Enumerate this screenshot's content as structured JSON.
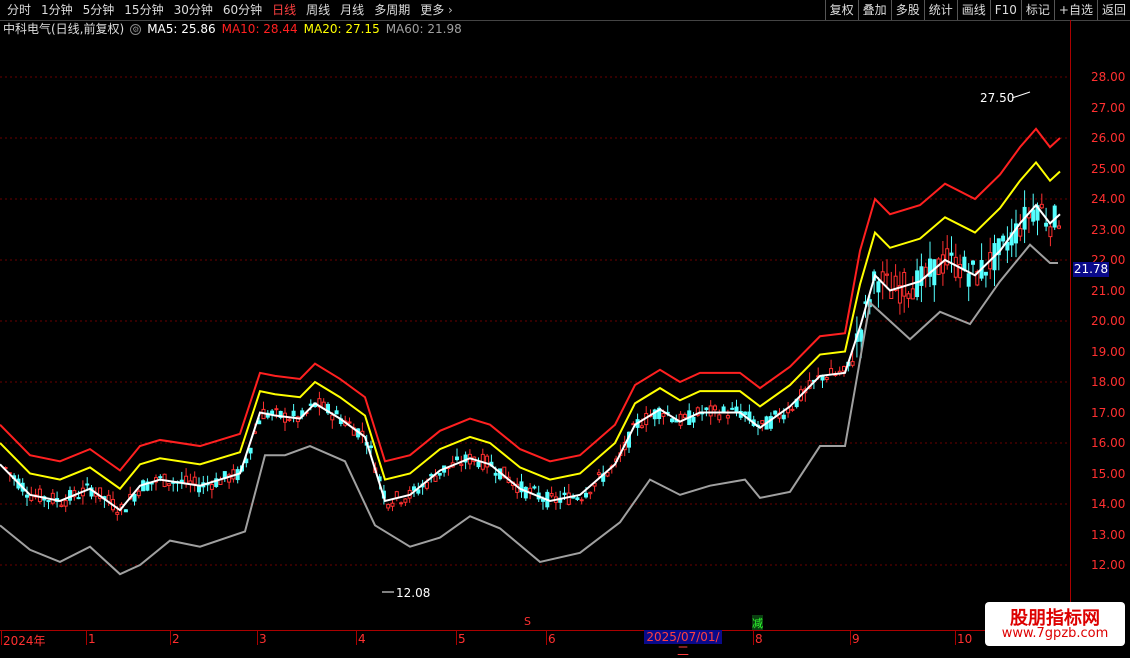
{
  "topbar": {
    "periods": [
      "分时",
      "1分钟",
      "5分钟",
      "15分钟",
      "30分钟",
      "60分钟",
      "日线",
      "周线",
      "月线",
      "多周期",
      "更多"
    ],
    "active_period": "日线",
    "tools": [
      "复权",
      "叠加",
      "多股",
      "统计",
      "画线",
      "F10",
      "标记",
      "+自选",
      "返回"
    ]
  },
  "legend": {
    "stock_name": "中科电气(日线,前复权)",
    "ma5": "MA5: 25.86",
    "ma10": "MA10: 28.44",
    "ma20": "MA20: 27.15",
    "ma60": "MA60: 21.98",
    "colors": {
      "ma5": "#ffffff",
      "ma10": "#ff2020",
      "ma20": "#ffff00",
      "ma60": "#a0a0a0"
    }
  },
  "price_axis": {
    "ticks": [
      "28.00",
      "27.00",
      "26.00",
      "25.00",
      "24.00",
      "23.00",
      "22.00",
      "21.00",
      "20.00",
      "19.00",
      "18.00",
      "17.00",
      "16.00",
      "15.00",
      "14.00",
      "13.00",
      "12.00"
    ],
    "current_price": "21.78"
  },
  "annotations": {
    "high_label": "27.50",
    "low_label": "12.08",
    "s_marker": "S",
    "reduce_marker": "减"
  },
  "bottom": {
    "months": [
      "2024年",
      "1",
      "2",
      "3",
      "4",
      "5",
      "6",
      "8",
      "9",
      "10"
    ],
    "current_date": "2025/07/01/二"
  },
  "watermark": {
    "line1": "股朋指标网",
    "line2": "www.7gpzb.com"
  },
  "colors": {
    "up": "#ff3030",
    "down": "#54ffff",
    "grid": "#8b0000"
  }
}
